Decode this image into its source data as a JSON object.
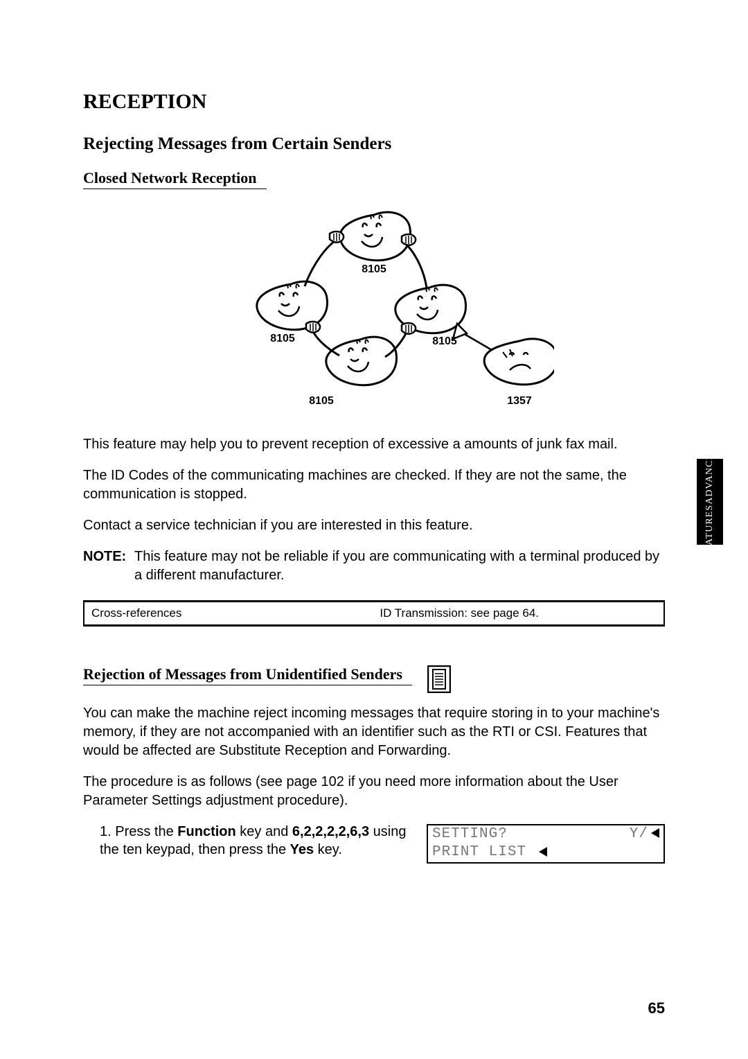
{
  "heading1": "RECEPTION",
  "heading2": "Rejecting Messages from Certain Senders",
  "section1": {
    "title": "Closed Network Reception",
    "figure": {
      "label_top": "8105",
      "label_left": "8105",
      "label_bottom": "8105",
      "label_right_in": "8105",
      "label_outside": "1357"
    },
    "p1": "This feature may help you to prevent reception of excessive a amounts of junk fax mail.",
    "p2": "The ID Codes of the communicating machines are checked. If they are not the same, the communication is stopped.",
    "p3": "Contact a service technician if you are interested in this feature.",
    "note_label": "NOTE:",
    "note_body": "This feature may not be reliable if you are communicating with a terminal produced by a different manufacturer.",
    "xref_left": "Cross-references",
    "xref_right": "ID Transmission: see page 64."
  },
  "section2": {
    "title": "Rejection of Messages from Unidentified Senders",
    "p1": "You can make the machine reject incoming messages that require storing in to your machine's memory, if they are not accompanied with an identifier such as the RTI or CSI. Features that would be affected are Substitute Reception and Forwarding.",
    "p2": "The procedure is as follows (see page 102 if you need more information about the User Parameter Settings adjustment procedure).",
    "step1": {
      "num": "1.",
      "t1": "Press the ",
      "b1": "Function",
      "t2": " key and ",
      "b2": "6,2,2,2,2,6,3",
      "t3": " using the ten keypad, then press the ",
      "b3": "Yes",
      "t4": " key."
    },
    "lcd": {
      "line1_left": "SETTING?",
      "line1_right": "Y/",
      "line2_left": "PRINT LIST"
    }
  },
  "side_tab": {
    "line1": "ADVANCED",
    "line2": "FEATURES"
  },
  "page_number": "65"
}
